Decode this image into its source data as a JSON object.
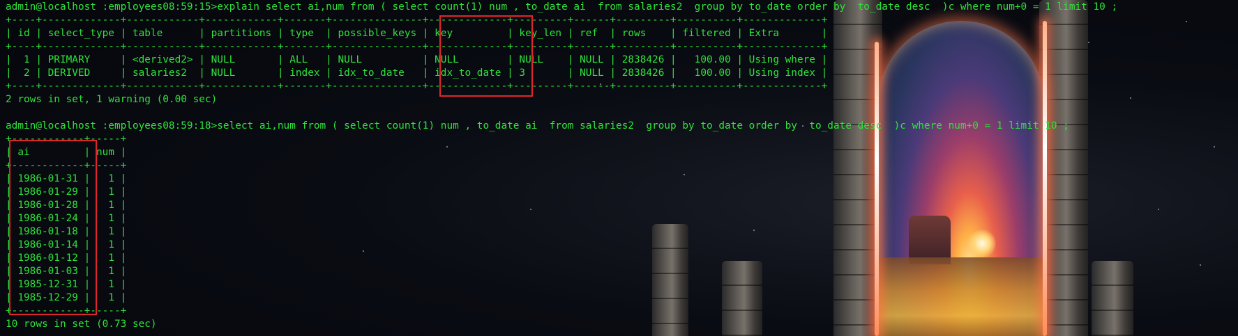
{
  "terminal": {
    "text_color": "#2fe33a",
    "highlight_color": "#e0262b",
    "lines": [
      "admin@localhost :employees08:59:15>explain select ai,num from ( select count(1) num , to_date ai  from salaries2  group by to_date order by  to_date desc  )c where num+0 = 1 limit 10 ;",
      "+----+-------------+------------+------------+-------+---------------+-------------+---------+------+---------+----------+-------------+",
      "| id | select_type | table      | partitions | type  | possible_keys | key         | key_len | ref  | rows    | filtered | Extra       |",
      "+----+-------------+------------+------------+-------+---------------+-------------+---------+------+---------+----------+-------------+",
      "|  1 | PRIMARY     | <derived2> | NULL       | ALL   | NULL          | NULL        | NULL    | NULL | 2838426 |   100.00 | Using where |",
      "|  2 | DERIVED     | salaries2  | NULL       | index | idx_to_date   | idx_to_date | 3       | NULL | 2838426 |   100.00 | Using index |",
      "+----+-------------+------------+------------+-------+---------------+-------------+---------+------+---------+----------+-------------+",
      "2 rows in set, 1 warning (0.00 sec)",
      "",
      "admin@localhost :employees08:59:18>select ai,num from ( select count(1) num , to_date ai  from salaries2  group by to_date order by  to_date desc  )c where num+0 = 1 limit 10 ;",
      "+------------+-----+",
      "| ai         | num |",
      "+------------+-----+",
      "| 1986-01-31 |   1 |",
      "| 1986-01-29 |   1 |",
      "| 1986-01-28 |   1 |",
      "| 1986-01-24 |   1 |",
      "| 1986-01-18 |   1 |",
      "| 1986-01-14 |   1 |",
      "| 1986-01-12 |   1 |",
      "| 1986-01-03 |   1 |",
      "| 1985-12-31 |   1 |",
      "| 1985-12-29 |   1 |",
      "+------------+-----+",
      "10 rows in set (0.73 sec)"
    ]
  }
}
